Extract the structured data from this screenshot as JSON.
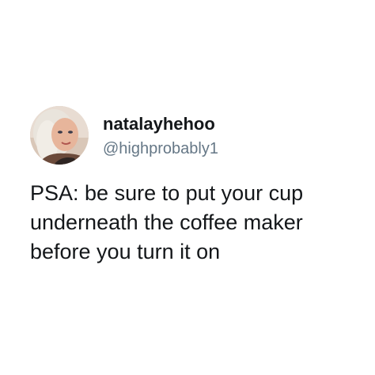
{
  "tweet": {
    "display_name": "natalayhehoo",
    "handle": "@highprobably1",
    "avatar_icon": "profile-photo",
    "text_lines": [
      "PSA: be sure to put your cup",
      "underneath the coffee maker",
      "before you turn it on"
    ]
  },
  "colors": {
    "name": "#14171a",
    "handle": "#657786",
    "background": "#ffffff"
  }
}
